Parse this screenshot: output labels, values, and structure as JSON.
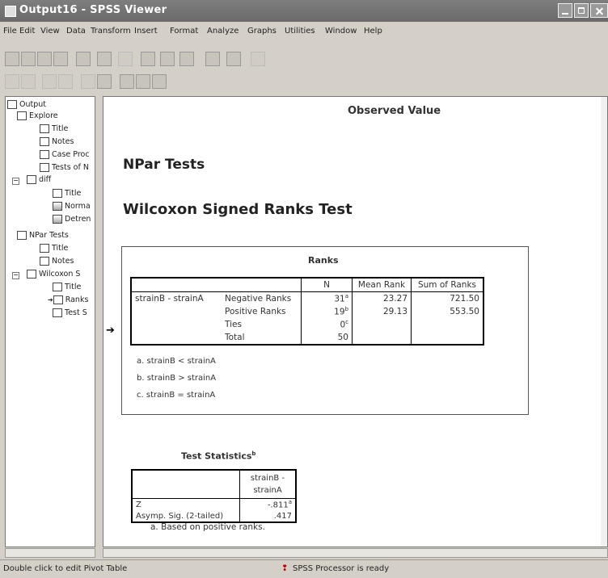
{
  "window": {
    "title": "Output16 - SPSS Viewer"
  },
  "menu": [
    "File",
    "Edit",
    "View",
    "Data",
    "Transform",
    "Insert",
    "Format",
    "Analyze",
    "Graphs",
    "Utilities",
    "Window",
    "Help"
  ],
  "tree": [
    {
      "label": "Output",
      "indent": 0
    },
    {
      "label": "Explore",
      "indent": 1
    },
    {
      "label": "Title",
      "indent": 2
    },
    {
      "label": "Notes",
      "indent": 2
    },
    {
      "label": "Case Proc",
      "indent": 2
    },
    {
      "label": "Tests of N",
      "indent": 2
    },
    {
      "label": "diff",
      "indent": 2
    },
    {
      "label": "Title",
      "indent": 3
    },
    {
      "label": "Norma",
      "indent": 3
    },
    {
      "label": "Detren",
      "indent": 3
    },
    {
      "label": "NPar Tests",
      "indent": 1
    },
    {
      "label": "Title",
      "indent": 2
    },
    {
      "label": "Notes",
      "indent": 2
    },
    {
      "label": "Wilcoxon S",
      "indent": 2
    },
    {
      "label": "Title",
      "indent": 3
    },
    {
      "label": "Ranks",
      "indent": 3
    },
    {
      "label": "Test S",
      "indent": 3
    }
  ],
  "output": {
    "observed_value": "Observed Value",
    "npar_title": "NPar Tests",
    "wilcoxon_title": "Wilcoxon Signed Ranks Test",
    "ranks": {
      "title": "Ranks",
      "headers": [
        "N",
        "Mean Rank",
        "Sum of Ranks"
      ],
      "row_label": "strainB - strainA",
      "rows": [
        {
          "label": "Negative Ranks",
          "n": "31",
          "sup": "a",
          "mean": "23.27",
          "sum": "721.50"
        },
        {
          "label": "Positive Ranks",
          "n": "19",
          "sup": "b",
          "mean": "29.13",
          "sum": "553.50"
        },
        {
          "label": "Ties",
          "n": "0",
          "sup": "c",
          "mean": "",
          "sum": ""
        },
        {
          "label": "Total",
          "n": "50",
          "sup": "",
          "mean": "",
          "sum": ""
        }
      ],
      "footnotes": [
        "a. strainB < strainA",
        "b. strainB > strainA",
        "c. strainB = strainA"
      ]
    },
    "test_stats": {
      "title": "Test Statistics",
      "title_sup": "b",
      "col_header": [
        "strainB -",
        "strainA"
      ],
      "rows": [
        {
          "label": "Z",
          "value": "-.811",
          "sup": "a"
        },
        {
          "label": "Asymp. Sig. (2-tailed)",
          "value": ".417",
          "sup": ""
        }
      ],
      "footnote": "a. Based on positive ranks."
    }
  },
  "status": {
    "left": "Double click to edit Pivot Table",
    "processor": "SPSS Processor is ready"
  }
}
